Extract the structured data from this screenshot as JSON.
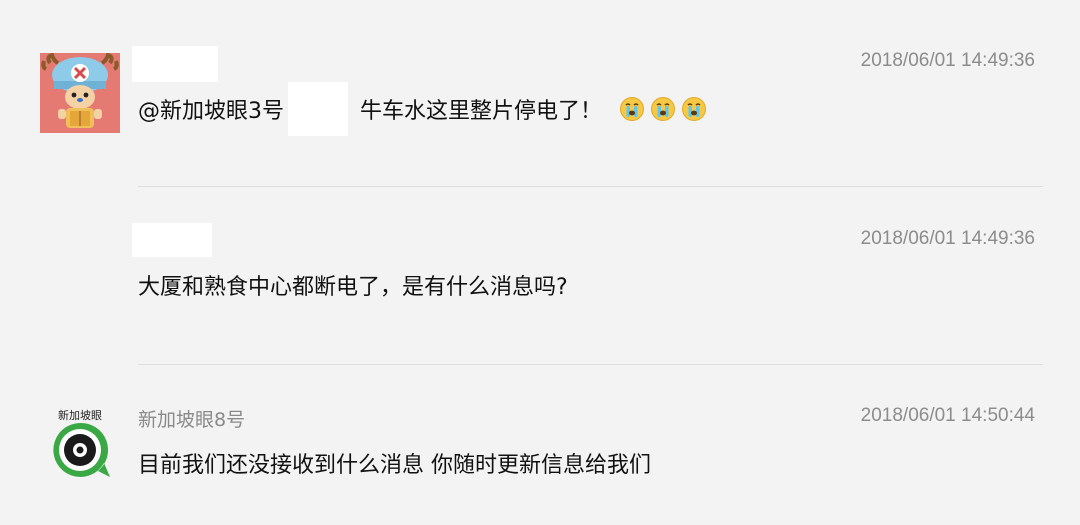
{
  "comments": [
    {
      "name": "",
      "timestamp": "2018/06/01 14:49:36",
      "text_prefix": "@新加坡眼3号",
      "text_main": "牛车水这里整片停电了！",
      "emojis": [
        "crying-face-icon",
        "crying-face-icon",
        "crying-face-icon"
      ],
      "avatar": "chopper-avatar"
    },
    {
      "name": "",
      "timestamp": "2018/06/01 14:49:36",
      "text": "大厦和熟食中心都断电了，是有什么消息吗?"
    },
    {
      "name": "新加坡眼8号",
      "timestamp": "2018/06/01 14:50:44",
      "text": "目前我们还没接收到什么消息 你随时更新信息给我们",
      "avatar": "eye-logo-avatar",
      "avatar_label": "新加坡眼"
    }
  ],
  "colors": {
    "background": "#f3f3f3",
    "divider": "#dedede",
    "timestamp": "#8c8c8c",
    "text": "#111111",
    "logo_green": "#3aa845"
  }
}
